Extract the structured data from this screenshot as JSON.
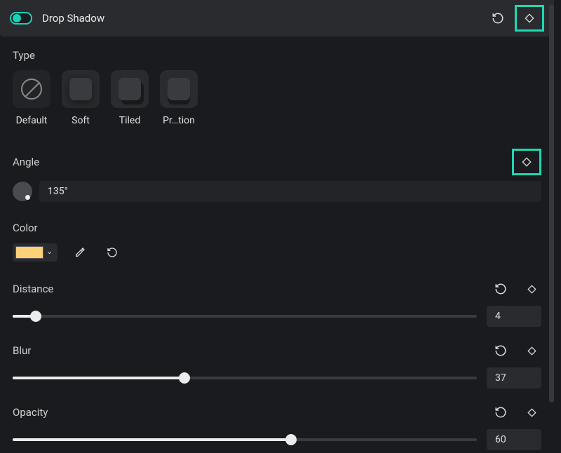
{
  "header": {
    "title": "Drop Shadow"
  },
  "type": {
    "label": "Type",
    "items": [
      {
        "label": "Default"
      },
      {
        "label": "Soft"
      },
      {
        "label": "Tiled"
      },
      {
        "label": "Pr…tion"
      }
    ]
  },
  "angle": {
    "label": "Angle",
    "value": "135°"
  },
  "color": {
    "label": "Color",
    "swatch": "#ffd07a"
  },
  "distance": {
    "label": "Distance",
    "value": "4",
    "percent": 5
  },
  "blur": {
    "label": "Blur",
    "value": "37",
    "percent": 37
  },
  "opacity": {
    "label": "Opacity",
    "value": "60",
    "percent": 60
  }
}
